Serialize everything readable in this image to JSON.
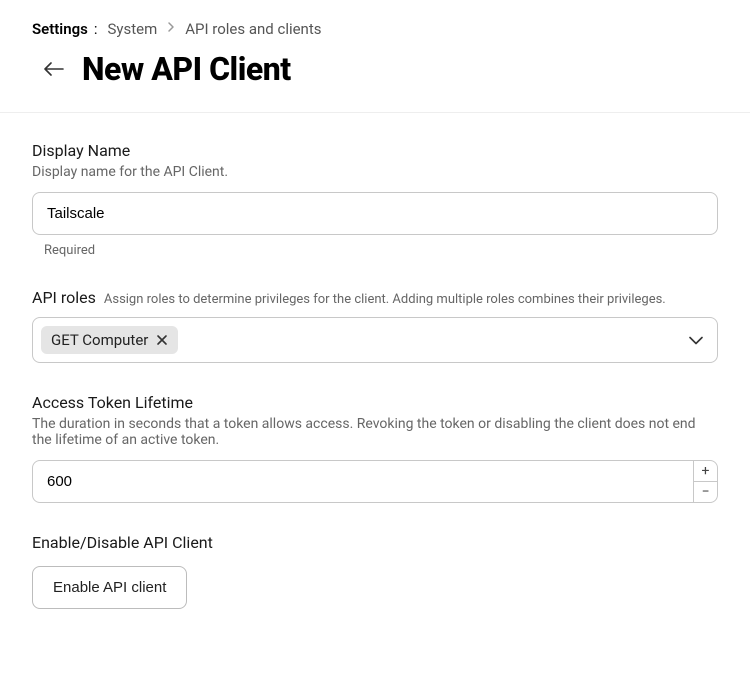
{
  "breadcrumbs": {
    "label": "Settings",
    "items": [
      "System",
      "API roles and clients"
    ]
  },
  "page": {
    "title": "New API Client"
  },
  "fields": {
    "display_name": {
      "label": "Display Name",
      "help": "Display name for the API Client.",
      "value": "Tailscale",
      "required_note": "Required"
    },
    "api_roles": {
      "label": "API roles",
      "help": "Assign roles to determine privileges for the client. Adding multiple roles combines their privileges.",
      "tags": [
        {
          "label": "GET Computer"
        }
      ]
    },
    "token_lifetime": {
      "label": "Access Token Lifetime",
      "help": "The duration in seconds that a token allows access. Revoking the token or disabling the client does not end the lifetime of an active token.",
      "value": "600"
    },
    "enable": {
      "label": "Enable/Disable API Client",
      "button": "Enable API client"
    }
  }
}
